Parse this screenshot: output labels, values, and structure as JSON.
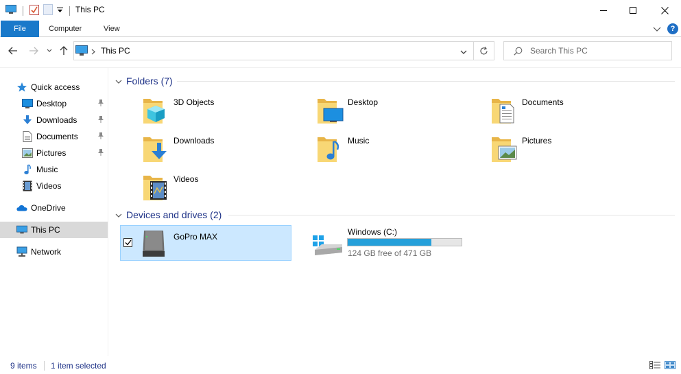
{
  "window": {
    "title": "This PC"
  },
  "ribbon": {
    "file": "File",
    "computer": "Computer",
    "view": "View",
    "help": "?"
  },
  "address": {
    "path": "This PC"
  },
  "search": {
    "placeholder": "Search This PC"
  },
  "sidebar": {
    "quick_access": "Quick access",
    "items": [
      {
        "label": "Desktop",
        "icon": "desktop-icon",
        "pinned": true
      },
      {
        "label": "Downloads",
        "icon": "downloads-icon",
        "pinned": true
      },
      {
        "label": "Documents",
        "icon": "documents-icon",
        "pinned": true
      },
      {
        "label": "Pictures",
        "icon": "pictures-icon",
        "pinned": true
      },
      {
        "label": "Music",
        "icon": "music-icon",
        "pinned": false
      },
      {
        "label": "Videos",
        "icon": "videos-icon",
        "pinned": false
      }
    ],
    "onedrive": "OneDrive",
    "this_pc": "This PC",
    "network": "Network"
  },
  "folders": {
    "heading": "Folders (7)",
    "items": [
      {
        "label": "3D Objects",
        "icon": "3d-objects-folder-icon"
      },
      {
        "label": "Desktop",
        "icon": "desktop-folder-icon"
      },
      {
        "label": "Documents",
        "icon": "documents-folder-icon"
      },
      {
        "label": "Downloads",
        "icon": "downloads-folder-icon"
      },
      {
        "label": "Music",
        "icon": "music-folder-icon"
      },
      {
        "label": "Pictures",
        "icon": "pictures-folder-icon"
      },
      {
        "label": "Videos",
        "icon": "videos-folder-icon"
      }
    ]
  },
  "devices": {
    "heading": "Devices and drives (2)",
    "gopro": {
      "label": "GoPro MAX",
      "icon": "removable-drive-icon",
      "selected": true
    },
    "windows": {
      "label": "Windows (C:)",
      "free": "124 GB free of 471 GB",
      "used_fraction": 0.737,
      "icon": "windows-drive-icon"
    }
  },
  "status": {
    "items": "9 items",
    "selected": "1 item selected"
  },
  "colors": {
    "accent": "#1979ca",
    "heading": "#1e3287",
    "selection": "#cce8ff",
    "bar": "#26a0da"
  }
}
